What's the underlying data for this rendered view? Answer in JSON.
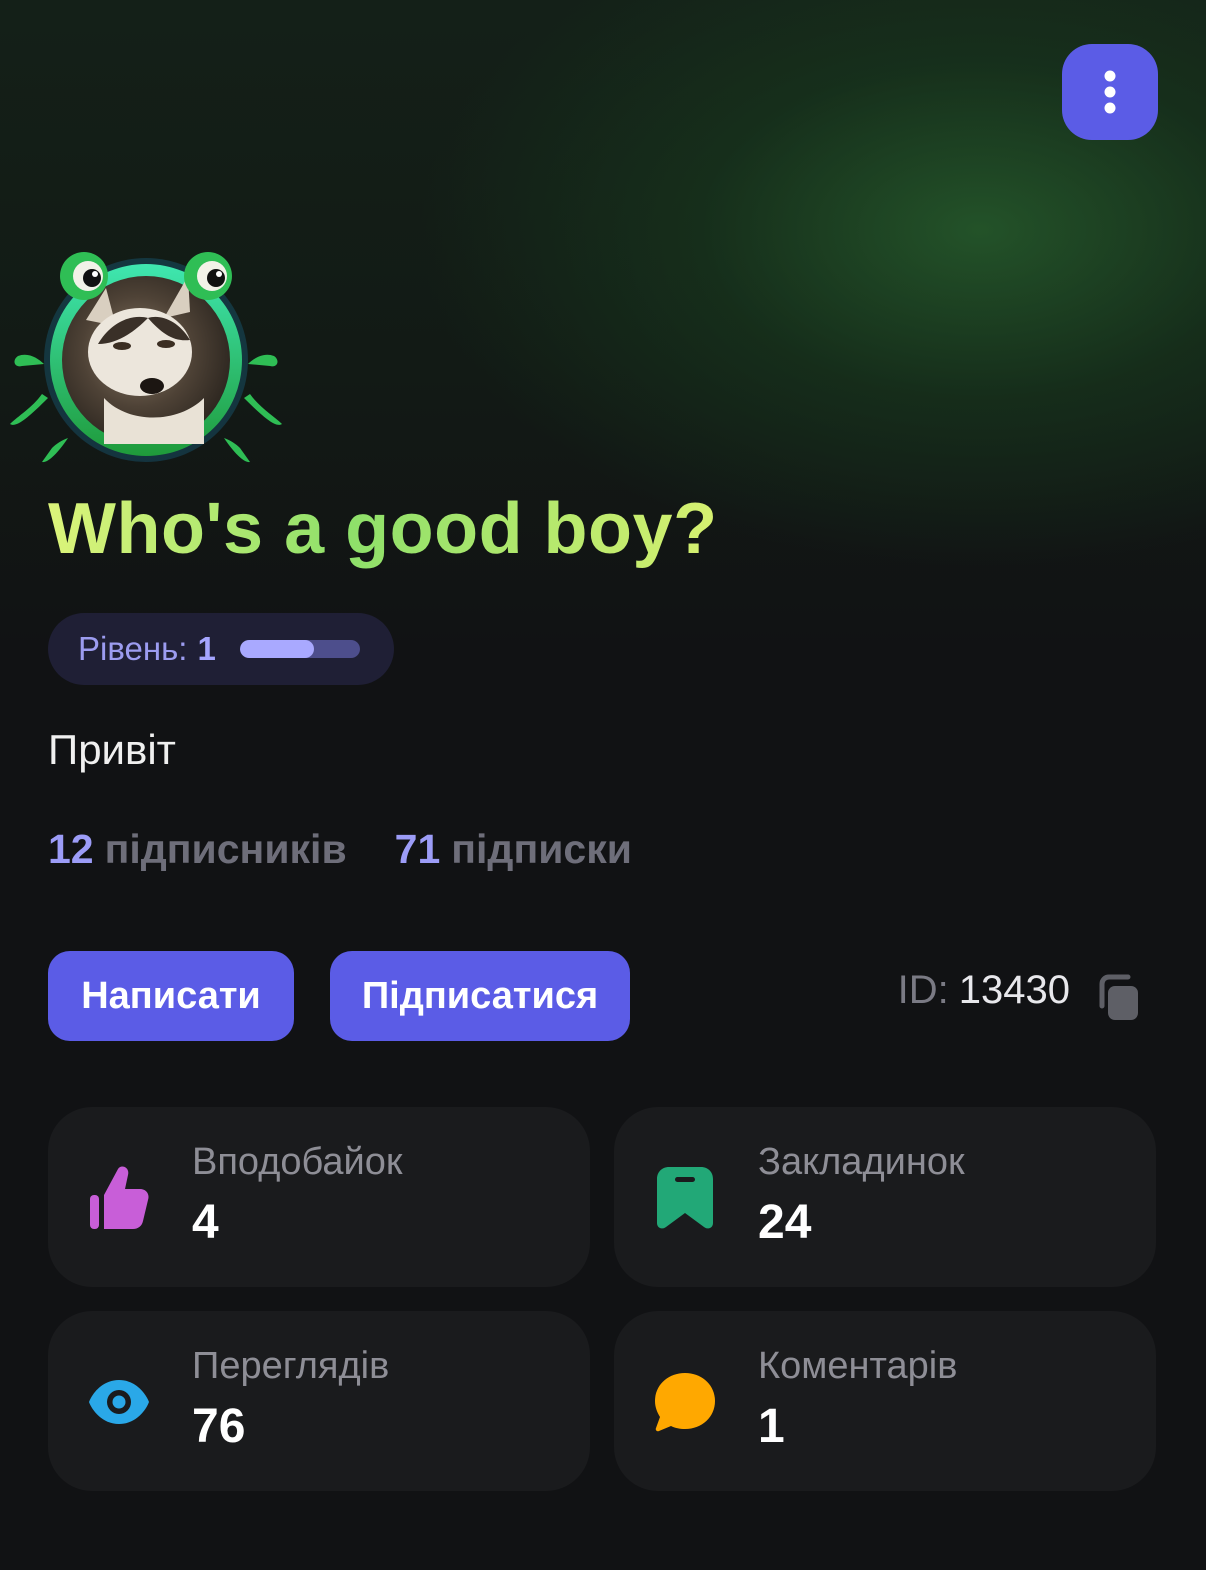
{
  "profile": {
    "name": "Who's a good boy?",
    "level_label": "Рівень:",
    "level_value": "1",
    "level_progress": 0.62,
    "bio": "Привіт",
    "followers_count": "12",
    "followers_label": "підписників",
    "following_count": "71",
    "following_label": "підписки",
    "id_label": "ID:",
    "id_value": "13430"
  },
  "actions": {
    "write_label": "Написати",
    "follow_label": "Підписатися"
  },
  "stats": [
    {
      "label": "Вподобайок",
      "value": "4",
      "icon": "thumbs-up-icon",
      "color": "#c85ed8"
    },
    {
      "label": "Закладинок",
      "value": "24",
      "icon": "bookmark-icon",
      "color": "#22a877"
    },
    {
      "label": "Переглядів",
      "value": "76",
      "icon": "eye-icon",
      "color": "#2aa8e8"
    },
    {
      "label": "Коментарів",
      "value": "1",
      "icon": "comment-icon",
      "color": "#ffa800"
    }
  ],
  "colors": {
    "accent": "#5b5ce6",
    "title_gradient_start": "#dcf47a",
    "title_gradient_mid": "#8ee06a",
    "link_number": "#9c9cf7"
  }
}
